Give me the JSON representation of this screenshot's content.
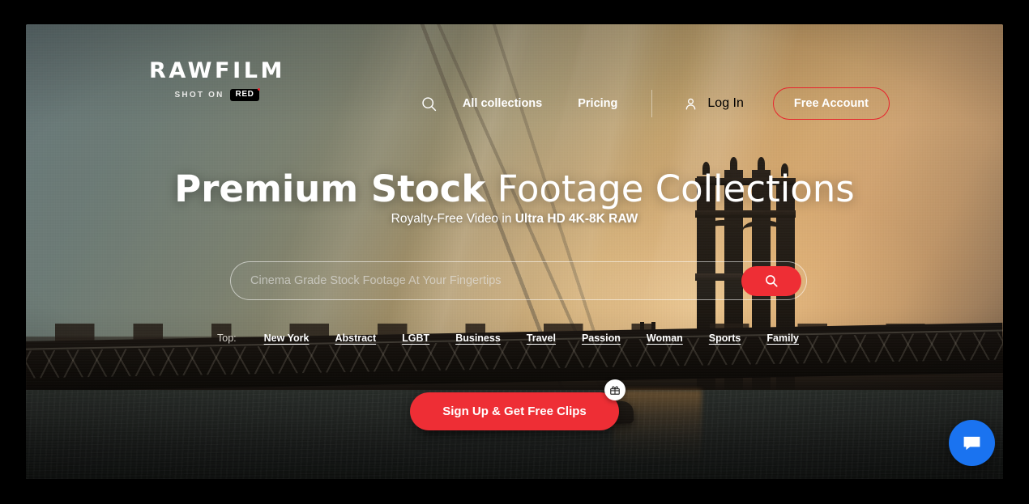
{
  "brand": {
    "name": "RAWFILM",
    "tagline_prefix": "SHOT ON",
    "tagline_badge": "RED"
  },
  "nav": {
    "search_icon": "search-icon",
    "links": [
      {
        "label": "All collections"
      },
      {
        "label": "Pricing"
      }
    ],
    "user_icon": "person-icon",
    "login_label": "Log In",
    "free_account_label": "Free Account"
  },
  "hero": {
    "headline_bold": "Premium Stock",
    "headline_light": " Footage Collections",
    "subhead_regular": "Royalty-Free Video in ",
    "subhead_bold": "Ultra HD 4K-8K RAW"
  },
  "search": {
    "placeholder": "Cinema Grade Stock Footage At Your Fingertips",
    "value": "",
    "submit_icon": "search-icon"
  },
  "tags": {
    "label": "Top:",
    "items": [
      {
        "label": "New York"
      },
      {
        "label": "Abstract"
      },
      {
        "label": "LGBT"
      },
      {
        "label": "Business"
      },
      {
        "label": "Travel"
      },
      {
        "label": "Passion"
      },
      {
        "label": "Woman"
      },
      {
        "label": "Sports"
      },
      {
        "label": "Family"
      }
    ]
  },
  "cta": {
    "label": "Sign Up & Get Free Clips",
    "badge_icon": "gift-icon"
  },
  "chat": {
    "icon": "chat-bubble-icon"
  },
  "colors": {
    "brand_red": "#ee2e35",
    "accent_red": "#e8222c",
    "chat_blue": "#1a73f0",
    "text_light": "#ffffff"
  }
}
